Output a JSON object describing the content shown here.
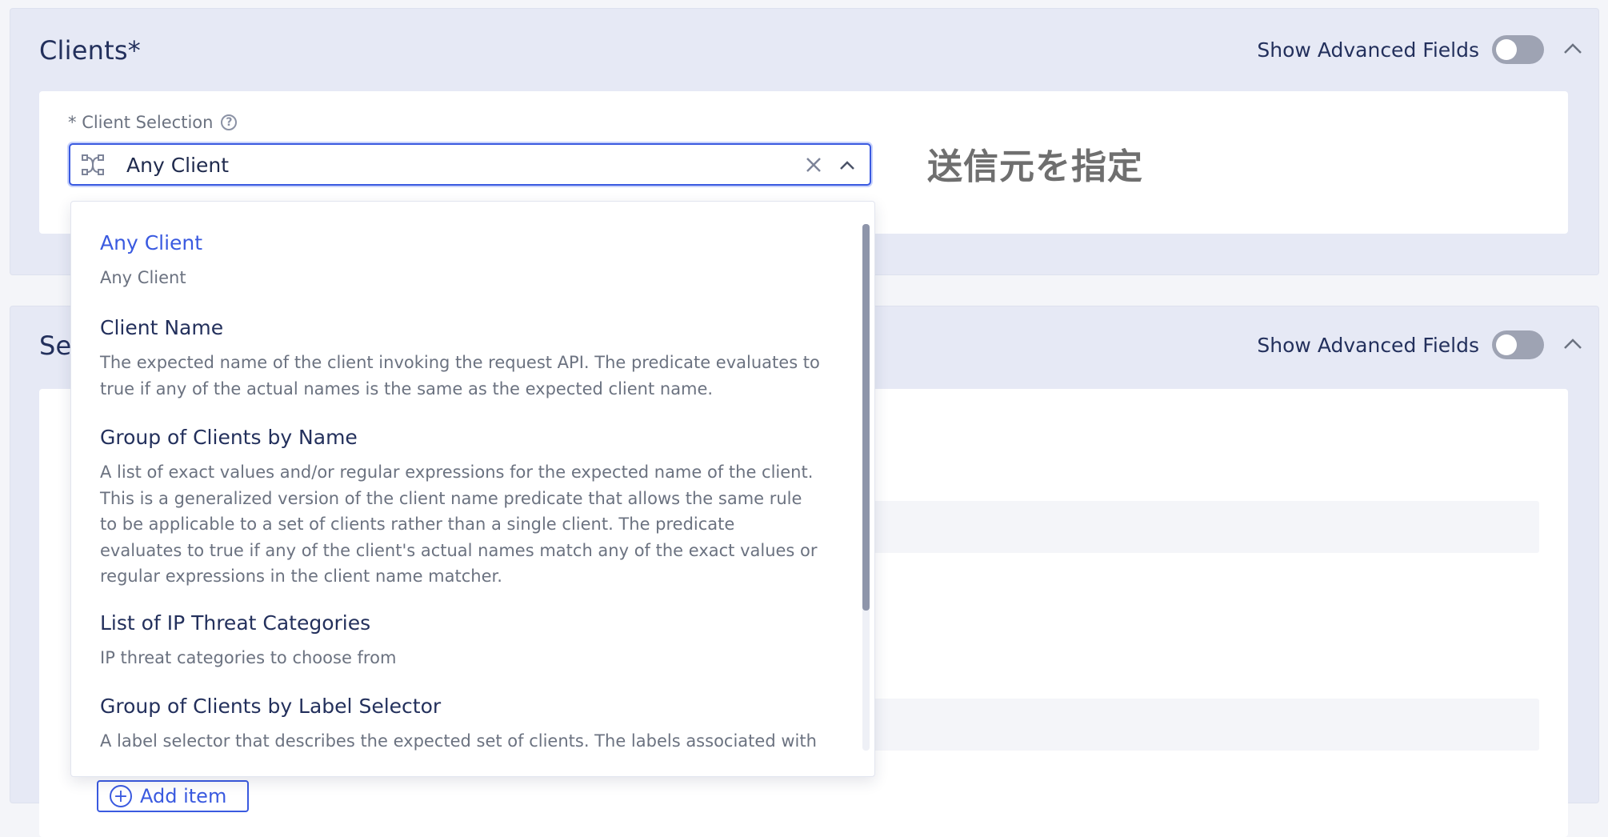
{
  "clients_section": {
    "title": "Clients",
    "required_mark": "*",
    "advanced_label": "Show Advanced Fields",
    "advanced_enabled": false
  },
  "client_selection": {
    "required_mark": "*",
    "label": "Client Selection",
    "help_glyph": "?",
    "value": "Any Client"
  },
  "annotation": "送信元を指定",
  "second_section": {
    "title_visible": "Se",
    "advanced_label": "Show Advanced Fields",
    "advanced_enabled": false,
    "add_item_label": "Add item"
  },
  "dropdown": {
    "options": [
      {
        "title": "Any Client",
        "description": "Any Client",
        "selected": true
      },
      {
        "title": "Client Name",
        "description": "The expected name of the client invoking the request API. The predicate evaluates to true if any of the actual names is the same as the expected client name.",
        "selected": false
      },
      {
        "title": "Group of Clients by Name",
        "description": "A list of exact values and/or regular expressions for the expected name of the client. This is a generalized version of the client name predicate that allows the same rule to be applicable to a set of clients rather than a single client. The predicate evaluates to true if any of the client's actual names match any of the exact values or regular expressions in the client name matcher.",
        "selected": false
      },
      {
        "title": "List of IP Threat Categories",
        "description": "IP threat categories to choose from",
        "selected": false
      },
      {
        "title": "Group of Clients by Label Selector",
        "description": "A label selector that describes the expected set of clients. The labels associated with",
        "selected": false
      }
    ]
  },
  "colors": {
    "accent": "#3a5ae0",
    "section_bg": "#e6e9f5",
    "toggle_off": "#9ea3b3",
    "annotation": "#6f6f6f"
  },
  "icons": {
    "select_lead": "nodes-icon",
    "clear": "close-icon",
    "caret": "chevron-up-icon",
    "collapse": "chevron-up-icon",
    "help": "question-circle-icon",
    "add": "plus-circle-icon"
  }
}
